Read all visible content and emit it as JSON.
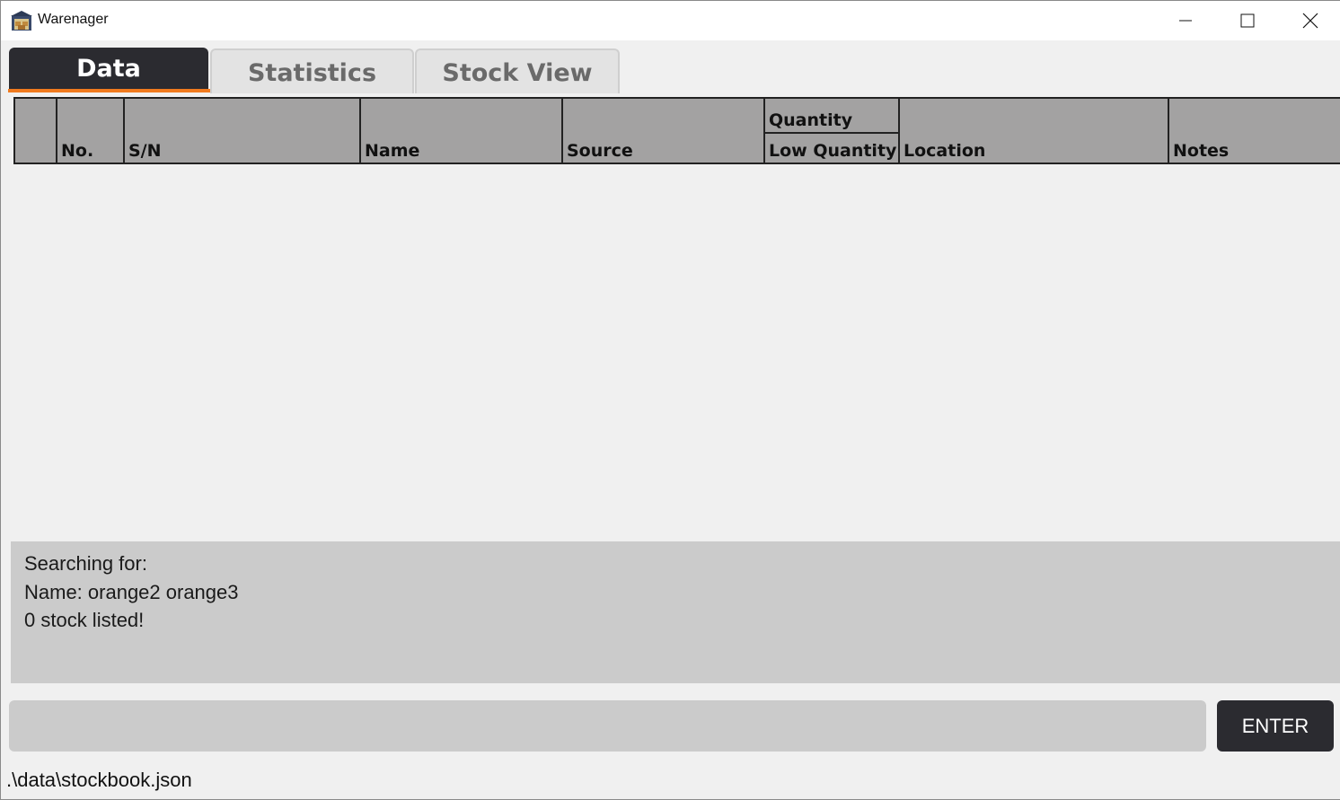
{
  "window": {
    "title": "Warenager",
    "icon": "warehouse-app-icon",
    "controls": [
      "minimize-icon",
      "maximize-icon",
      "close-icon"
    ]
  },
  "tabs": [
    {
      "label": "Data",
      "active": true
    },
    {
      "label": "Statistics",
      "active": false
    },
    {
      "label": "Stock View",
      "active": false
    }
  ],
  "table": {
    "columns": {
      "blank": "",
      "no": "No.",
      "sn": "S/N",
      "name": "Name",
      "source": "Source",
      "quantity": "Quantity",
      "low_quantity": "Low Quantity",
      "location": "Location",
      "notes": "Notes"
    },
    "rows": []
  },
  "result": {
    "line1": "Searching for:",
    "line2": "Name: orange2 orange3",
    "line3": "0 stock listed!"
  },
  "command": {
    "value": "",
    "button_label": "ENTER"
  },
  "status": {
    "file_path": ".\\data\\stockbook.json"
  },
  "colors": {
    "accent": "#f07a1e",
    "dark": "#2b2b30",
    "header_bg": "#a3a2a2",
    "panel_bg": "#cbcbcb"
  }
}
